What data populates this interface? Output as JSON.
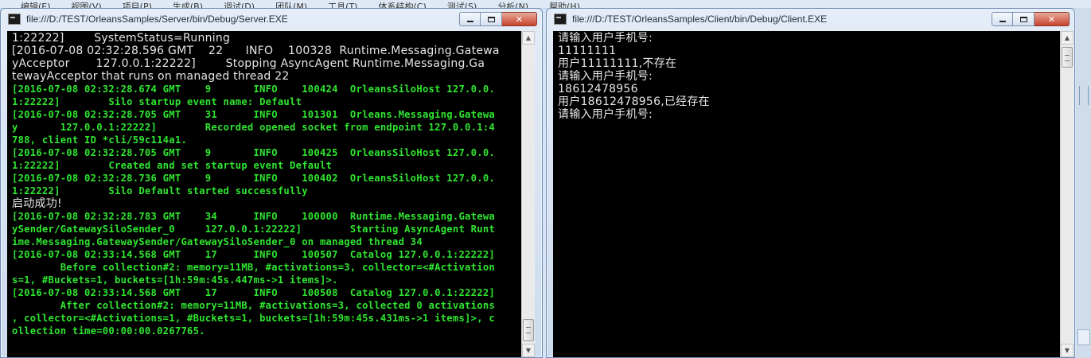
{
  "background_menu": [
    "编辑(E)",
    "视图(V)",
    "项目(P)",
    "生成(B)",
    "调试(D)",
    "团队(M)",
    "工具(T)",
    "体系结构(C)",
    "测试(S)",
    "分析(N)",
    "帮助(H)"
  ],
  "server": {
    "title": "file:///D:/TEST/OrleansSamples/Server/bin/Debug/Server.EXE",
    "icon": "console-app-icon",
    "lines": [
      {
        "c": "white",
        "t": "1:22222]        SystemStatus=Running"
      },
      {
        "c": "white",
        "t": "[2016-07-08 02:32:28.596 GMT    22      INFO    100328  Runtime.Messaging.Gatewa"
      },
      {
        "c": "white",
        "t": "yAcceptor       127.0.0.1:22222]        Stopping AsyncAgent Runtime.Messaging.Ga"
      },
      {
        "c": "white",
        "t": "tewayAcceptor that runs on managed thread 22"
      },
      {
        "c": "green",
        "t": "[2016-07-08 02:32:28.674 GMT    9       INFO    100424  OrleansSiloHost 127.0.0."
      },
      {
        "c": "green",
        "t": "1:22222]        Silo startup event name: Default"
      },
      {
        "c": "green",
        "t": "[2016-07-08 02:32:28.705 GMT    31      INFO    101301  Orleans.Messaging.Gatewa"
      },
      {
        "c": "green",
        "t": "y       127.0.0.1:22222]        Recorded opened socket from endpoint 127.0.0.1:4"
      },
      {
        "c": "green",
        "t": "788, client ID *cli/59c114a1."
      },
      {
        "c": "green",
        "t": "[2016-07-08 02:32:28.705 GMT    9       INFO    100425  OrleansSiloHost 127.0.0."
      },
      {
        "c": "green",
        "t": "1:22222]        Created and set startup event Default"
      },
      {
        "c": "green",
        "t": "[2016-07-08 02:32:28.736 GMT    9       INFO    100402  OrleansSiloHost 127.0.0."
      },
      {
        "c": "green",
        "t": "1:22222]        Silo Default started successfully"
      },
      {
        "c": "cwhite",
        "t": "启动成功!"
      },
      {
        "c": "green",
        "t": "[2016-07-08 02:32:28.783 GMT    34      INFO    100000  Runtime.Messaging.Gatewa"
      },
      {
        "c": "green",
        "t": "ySender/GatewaySiloSender_0     127.0.0.1:22222]        Starting AsyncAgent Runt"
      },
      {
        "c": "green",
        "t": "ime.Messaging.GatewaySender/GatewaySiloSender_0 on managed thread 34"
      },
      {
        "c": "green",
        "t": "[2016-07-08 02:33:14.568 GMT    17      INFO    100507  Catalog 127.0.0.1:22222]"
      },
      {
        "c": "green",
        "t": "        Before collection#2: memory=11MB, #activations=3, collector=<#Activation"
      },
      {
        "c": "green",
        "t": "s=1, #Buckets=1, buckets=[1h:59m:45s.447ms->1 items]>."
      },
      {
        "c": "green",
        "t": "[2016-07-08 02:33:14.568 GMT    17      INFO    100508  Catalog 127.0.0.1:22222]"
      },
      {
        "c": "green",
        "t": "        After collection#2: memory=11MB, #activations=3, collected 0 activations"
      },
      {
        "c": "green",
        "t": ", collector=<#Activations=1, #Buckets=1, buckets=[1h:59m:45s.431ms->1 items]>, c"
      },
      {
        "c": "green",
        "t": "ollection time=00:00:00.0267765."
      }
    ]
  },
  "client": {
    "title": "file:///D:/TEST/OrleansSamples/Client/bin/Debug/Client.EXE",
    "icon": "console-app-icon",
    "lines": [
      {
        "c": "cwhite",
        "t": "请输入用户手机号:"
      },
      {
        "c": "white",
        "t": "11111111"
      },
      {
        "c": "cwhite",
        "t": "用户11111111,不存在"
      },
      {
        "c": "cwhite",
        "t": "请输入用户手机号:"
      },
      {
        "c": "white",
        "t": "18612478956"
      },
      {
        "c": "cwhite",
        "t": "用户18612478956,已经存在"
      },
      {
        "c": "cwhite",
        "t": "请输入用户手机号:"
      }
    ]
  },
  "caption_buttons": {
    "minimize": "minimize-icon",
    "maximize": "maximize-icon",
    "close": "close-icon",
    "close_glyph": "✕"
  },
  "colors": {
    "console_bg": "#000000",
    "console_green": "#2fe52f",
    "console_white": "#e6e6e6",
    "close_red": "#c7432c"
  }
}
